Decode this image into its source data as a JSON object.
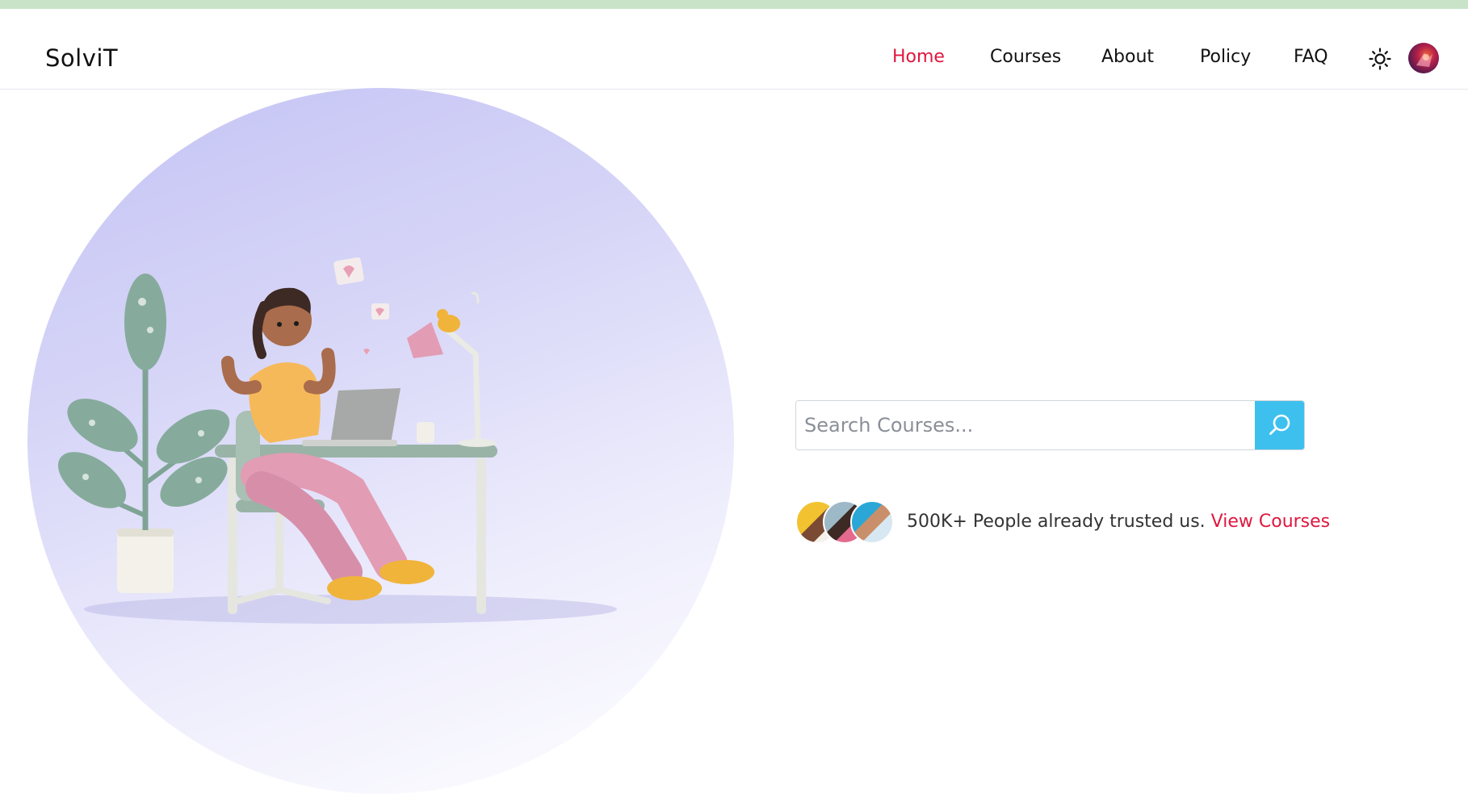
{
  "brand": {
    "name": "SolviT"
  },
  "nav": {
    "items": [
      {
        "label": "Home",
        "active": true
      },
      {
        "label": "Courses",
        "active": false
      },
      {
        "label": "About",
        "active": false
      },
      {
        "label": "Policy",
        "active": false
      },
      {
        "label": "FAQ",
        "active": false
      }
    ],
    "theme_icon": "sun-icon",
    "avatar_icon": "user-avatar"
  },
  "search": {
    "placeholder": "Search Courses...",
    "value": "",
    "button_icon": "search-icon"
  },
  "trust": {
    "text": "500K+ People already trusted us.",
    "link_label": "View Courses",
    "avatars": [
      "user-avatar-1",
      "user-avatar-2",
      "user-avatar-3"
    ]
  },
  "colors": {
    "accent": "#e0173f",
    "search_button": "#3ec0ee",
    "top_strip": "#c8e3c8",
    "hero_gradient_start": "#c4c3f5"
  }
}
